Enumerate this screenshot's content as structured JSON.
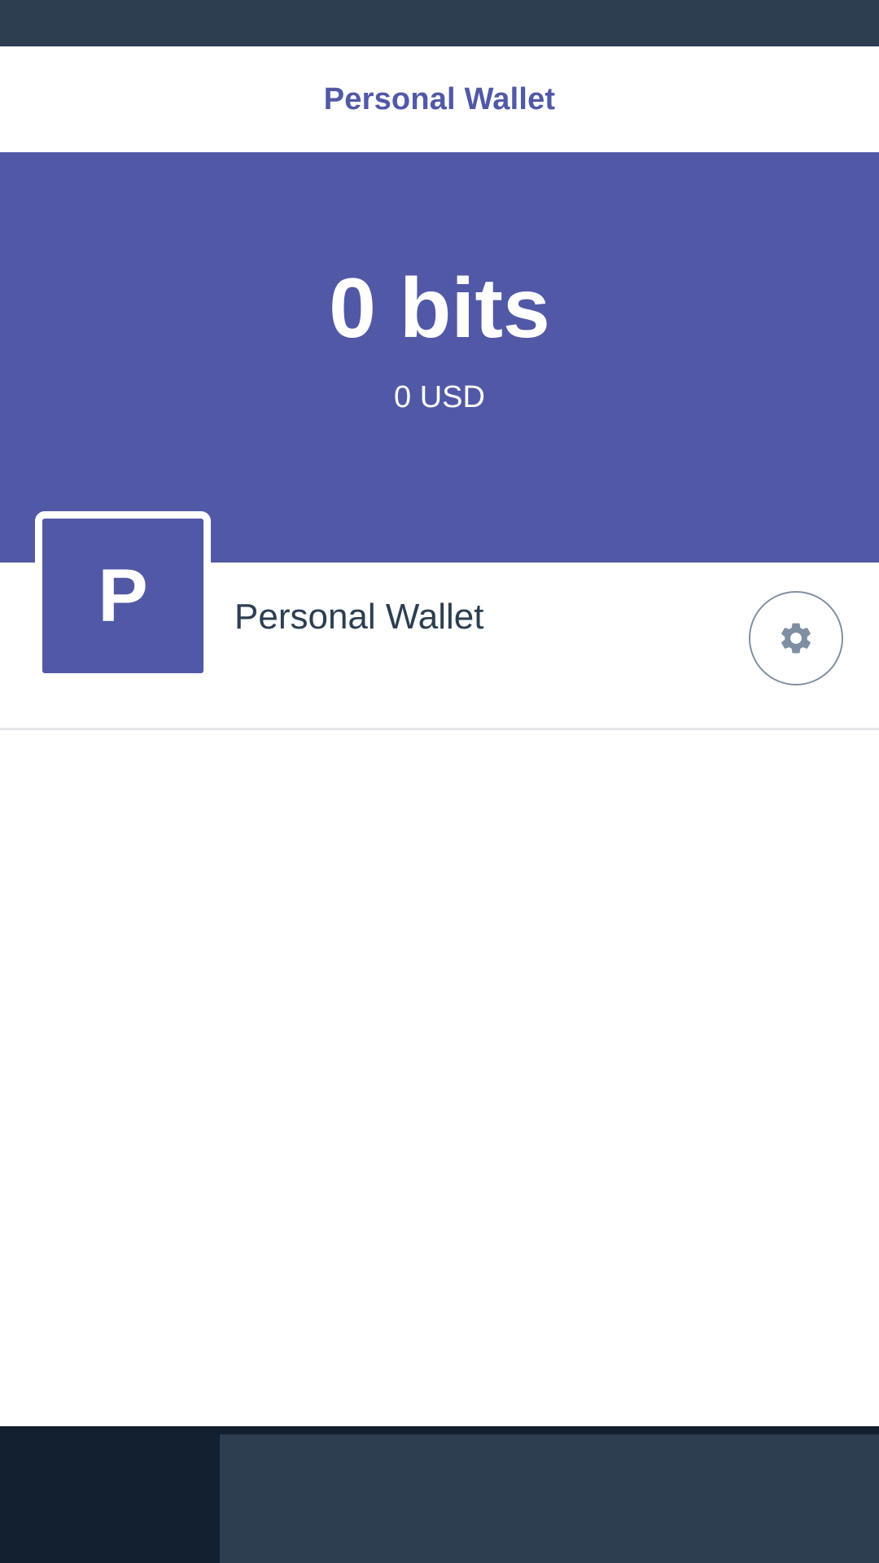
{
  "header": {
    "title": "Personal Wallet"
  },
  "balance": {
    "amount": "0 bits",
    "fiat": "0 USD"
  },
  "wallet": {
    "avatar_letter": "P",
    "name": "Personal Wallet",
    "settings_icon": "gear-icon"
  },
  "colors": {
    "accent": "#5159a6",
    "status_bar": "#2c3e50",
    "bottom_bar": "#13202f",
    "text_dark": "#2c3e50"
  }
}
